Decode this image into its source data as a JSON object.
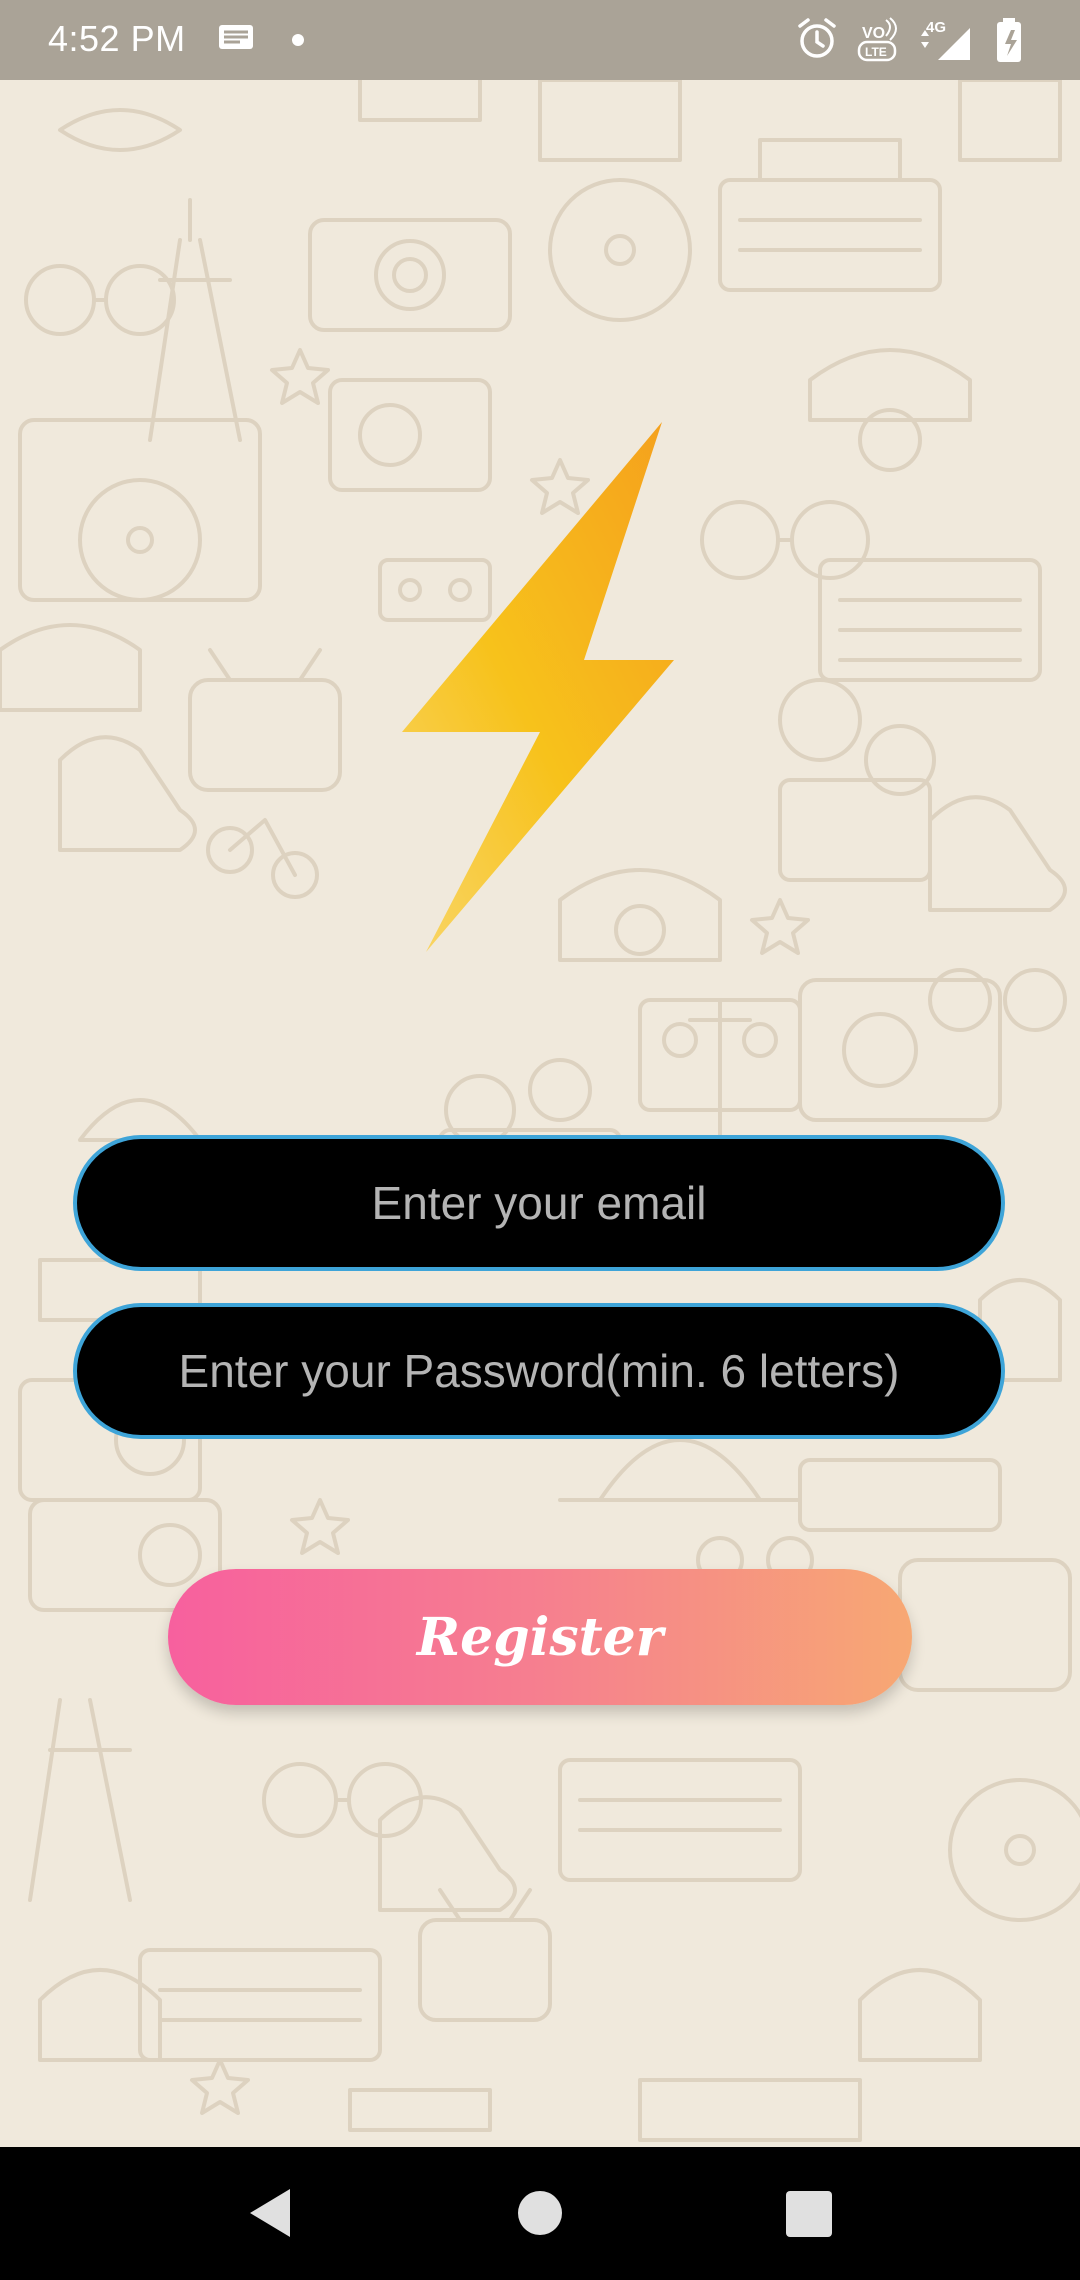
{
  "status_bar": {
    "time": "4:52 PM",
    "network": "4G",
    "icons": [
      "message-icon",
      "dot-icon",
      "alarm-icon",
      "volte-icon",
      "signal-icon",
      "battery-icon"
    ]
  },
  "logo": {
    "icon": "lightning-bolt-icon",
    "colors": [
      "#f7c21b",
      "#f5a01d"
    ]
  },
  "form": {
    "email_placeholder": "Enter your email",
    "password_placeholder": "Enter your Password(min. 6 letters)",
    "register_label": "Register"
  },
  "colors": {
    "background": "#f0e9dc",
    "field_fill": "#000000",
    "field_border": "#3ea4d8",
    "button_gradient": [
      "#f7609e",
      "#f7a873"
    ]
  },
  "nav_bar": {
    "icons": [
      "back-icon",
      "home-icon",
      "recents-icon"
    ]
  }
}
